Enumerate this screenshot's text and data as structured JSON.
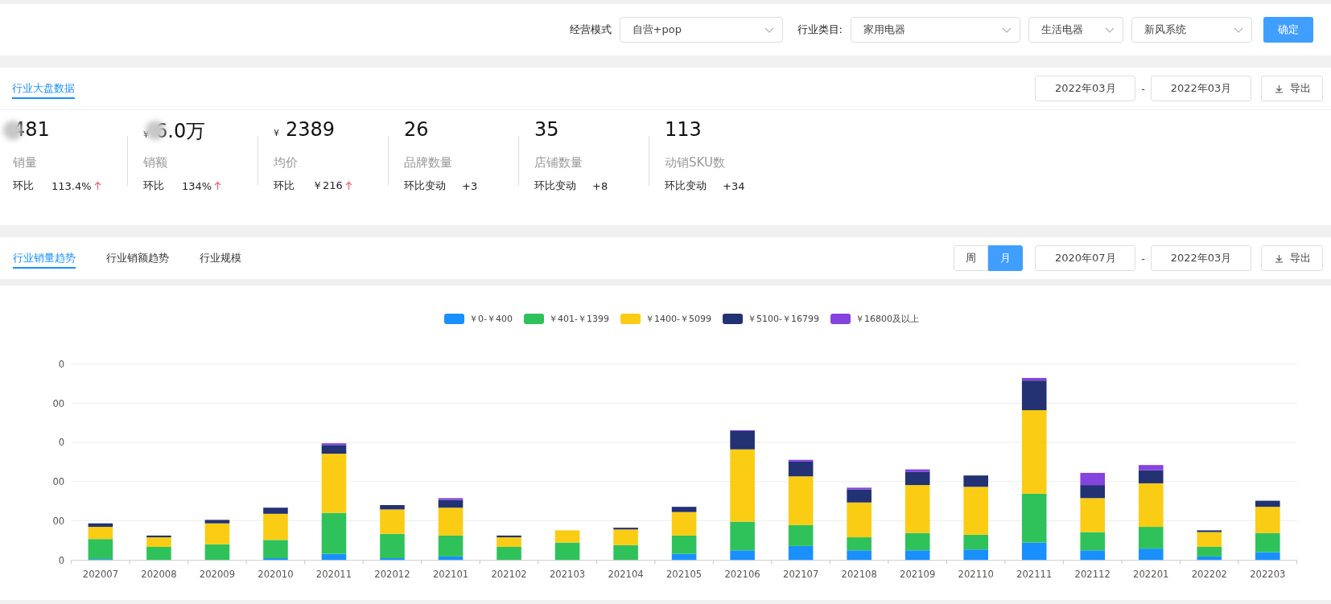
{
  "filters": {
    "items": [
      {
        "label": "经营模式",
        "value": "自营+pop"
      },
      {
        "label": "行业类目:",
        "value": "家用电器"
      },
      {
        "value": "生活电器"
      },
      {
        "value": "新风系统"
      }
    ],
    "confirm": "确定"
  },
  "overview": {
    "tab": {
      "label": "行业大盘数据",
      "selected": true
    },
    "date_from": "2022年03月",
    "separator": "-",
    "date_to": "2022年03月",
    "export": "导出",
    "stats": [
      {
        "value": "481",
        "blurred": true,
        "label": "销量",
        "compare_label": "环比",
        "compare_value": "113.4%",
        "up": true
      },
      {
        "currency": "¥",
        "value": "6.0万",
        "blurred": true,
        "label": "销额",
        "compare_label": "环比",
        "compare_value": "134%",
        "up": true
      },
      {
        "currency": "¥",
        "value": "2389",
        "label": "均价",
        "compare_label": "环比",
        "compare_value": "￥216",
        "up": true
      },
      {
        "value": "26",
        "label": "品牌数量",
        "compare_label": "环比变动",
        "compare_value": "+3"
      },
      {
        "value": "35",
        "label": "店铺数量",
        "compare_label": "环比变动",
        "compare_value": "+8"
      },
      {
        "value": "113",
        "label": "动销SKU数",
        "compare_label": "环比变动",
        "compare_value": "+34"
      }
    ]
  },
  "trend": {
    "tabs": [
      {
        "label": "行业销量趋势",
        "selected": true
      },
      {
        "label": "行业销额趋势",
        "selected": false
      },
      {
        "label": "行业规模",
        "selected": false
      }
    ],
    "periods": [
      {
        "label": "周",
        "selected": false
      },
      {
        "label": "月",
        "selected": true
      }
    ],
    "date_from": "2020年07月",
    "separator": "-",
    "date_to": "2022年03月",
    "export": "导出"
  },
  "chart": {
    "legend": [
      {
        "label": "￥0-￥400",
        "color": "#1890ff"
      },
      {
        "label": "￥401-￥1399",
        "color": "#2fc25b"
      },
      {
        "label": "￥1400-￥5099",
        "color": "#facc14"
      },
      {
        "label": "￥5100-￥16799",
        "color": "#223273"
      },
      {
        "label": "￥16800及以上",
        "color": "#8543e0"
      }
    ],
    "y_labels": [
      "0",
      "00",
      "0",
      "00",
      "00",
      "0"
    ],
    "x_labels": [
      "202007",
      "202008",
      "202009",
      "202010",
      "202011",
      "202012",
      "202101",
      "202102",
      "202103",
      "202104",
      "202105",
      "202106",
      "202107",
      "202108",
      "202109",
      "202110",
      "202111",
      "202112",
      "202201",
      "202202",
      "202203"
    ]
  }
}
